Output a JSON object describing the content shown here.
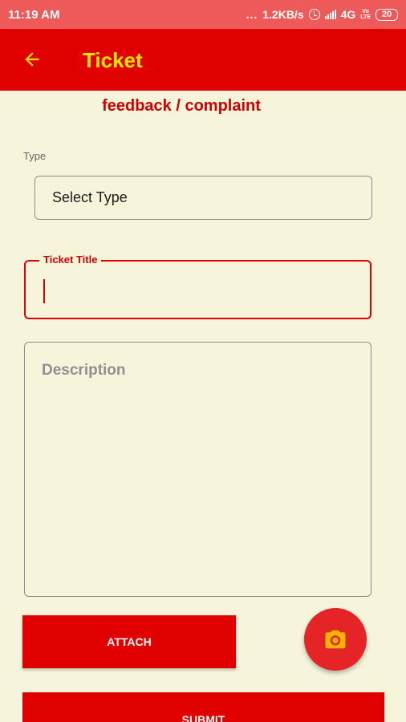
{
  "status_bar": {
    "time": "11:19 AM",
    "dots": "...",
    "speed": "1.2KB/s",
    "network": "4G",
    "volte_top": "Vo",
    "volte_bottom": "LTE",
    "battery": "20"
  },
  "app_bar": {
    "title": "Ticket",
    "back_icon": "arrow-left-icon"
  },
  "subtitle": "feedback / complaint",
  "type_field": {
    "label": "Type",
    "value": "Select Type"
  },
  "title_field": {
    "label": "Ticket Title",
    "value": ""
  },
  "description_field": {
    "placeholder": "Description",
    "value": ""
  },
  "buttons": {
    "attach": "ATTACH",
    "submit": "SUBMIT",
    "camera_icon": "camera-icon"
  },
  "colors": {
    "primary": "#e00000",
    "accent_text": "#ffe600",
    "background": "#f6f5dc",
    "status_bar": "#ee5a5a",
    "fab": "#e52428",
    "camera_icon": "#f4b400"
  }
}
